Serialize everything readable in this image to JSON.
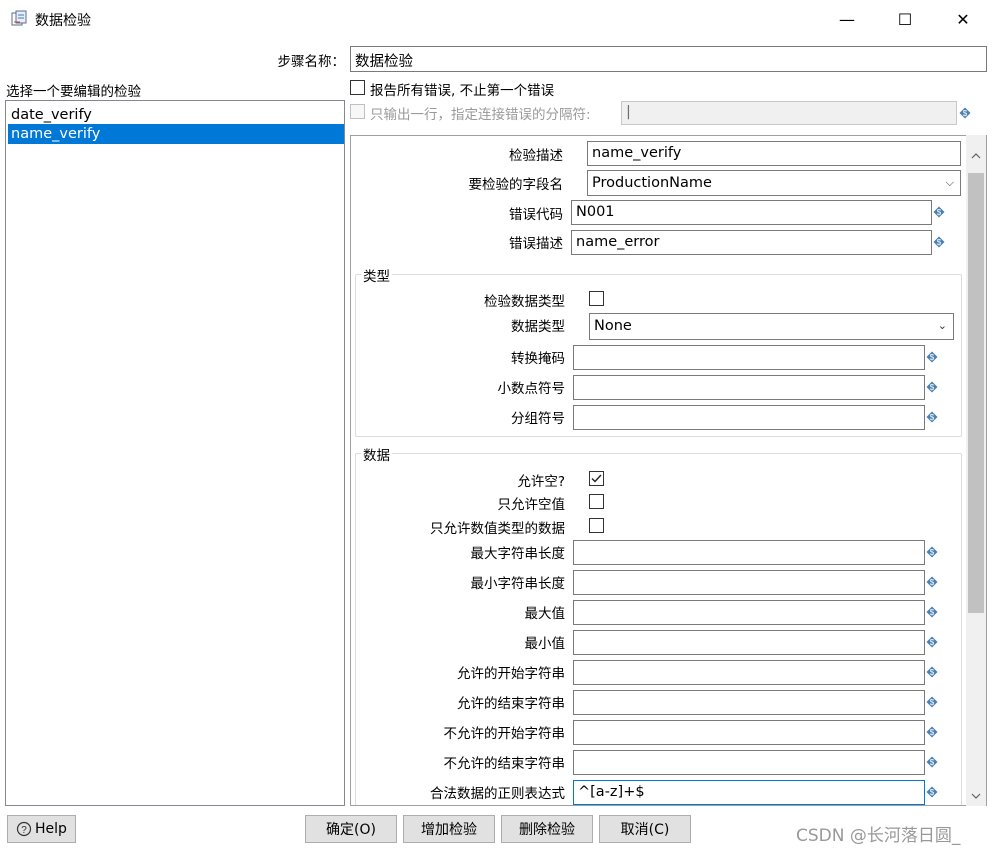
{
  "window": {
    "title": "数据检验",
    "minimize_glyph": "—",
    "maximize_glyph": "☐",
    "close_glyph": "✕"
  },
  "step_name": {
    "label": "步骤名称：",
    "value": "数据检验"
  },
  "validations_list": {
    "label": "选择一个要编辑的检验",
    "items": [
      "date_verify",
      "name_verify"
    ],
    "selected_index": 1
  },
  "options": {
    "report_all_errors": {
      "label": "报告所有错误, 不止第一个错误",
      "checked": false
    },
    "output_one_row": {
      "label": "只输出一行，指定连接错误的分隔符:",
      "checked": false,
      "disabled": true,
      "separator_value": "|"
    }
  },
  "detail": {
    "description": {
      "label": "检验描述",
      "value": "name_verify"
    },
    "field_name": {
      "label": "要检验的字段名",
      "value": "ProductionName"
    },
    "error_code": {
      "label": "错误代码",
      "value": "N001"
    },
    "error_description": {
      "label": "错误描述",
      "value": "name_error"
    }
  },
  "type_group": {
    "title": "类型",
    "check_data_type": {
      "label": "检验数据类型",
      "checked": false
    },
    "data_type": {
      "label": "数据类型",
      "value": "None"
    },
    "conversion_mask": {
      "label": "转换掩码",
      "value": ""
    },
    "decimal_symbol": {
      "label": "小数点符号",
      "value": ""
    },
    "grouping_symbol": {
      "label": "分组符号",
      "value": ""
    }
  },
  "data_group": {
    "title": "数据",
    "allow_null": {
      "label": "允许空?",
      "checked": true
    },
    "only_null": {
      "label": "只允许空值",
      "checked": false
    },
    "only_numeric": {
      "label": "只允许数值类型的数据",
      "checked": false
    },
    "max_length": {
      "label": "最大字符串长度",
      "value": ""
    },
    "min_length": {
      "label": "最小字符串长度",
      "value": ""
    },
    "max_value": {
      "label": "最大值",
      "value": ""
    },
    "min_value": {
      "label": "最小值",
      "value": ""
    },
    "allowed_start": {
      "label": "允许的开始字符串",
      "value": ""
    },
    "allowed_end": {
      "label": "允许的结束字符串",
      "value": ""
    },
    "disallowed_start": {
      "label": "不允许的开始字符串",
      "value": ""
    },
    "disallowed_end": {
      "label": "不允许的结束字符串",
      "value": ""
    },
    "regex_valid": {
      "label": "合法数据的正则表达式",
      "value": "^[a-z]+$"
    }
  },
  "buttons": {
    "help": "Help",
    "ok": "确定(O)",
    "add": "增加检验",
    "delete": "删除检验",
    "cancel": "取消(C)"
  },
  "watermark": "CSDN @长河落日圆_",
  "colors": {
    "selection": "#0078d7",
    "focus_border": "#0078d7",
    "button_bg": "#e1e1e1"
  }
}
